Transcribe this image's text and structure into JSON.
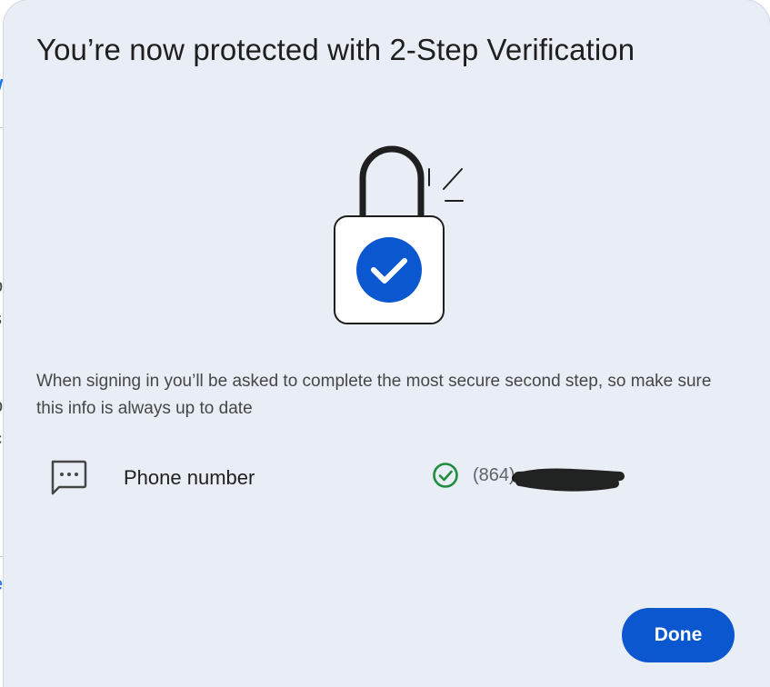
{
  "dialog": {
    "title": "You’re now protected with 2-Step Verification",
    "description": "When signing in you’ll be asked to complete the most secure second step, so make sure this info is always up to date",
    "illustration": "padlock-with-check",
    "info_rows": [
      {
        "icon": "sms-message-icon",
        "label": "Phone number",
        "status_icon": "check-circle-icon",
        "status_color": "#1e8e3e",
        "value": "(864)"
      }
    ],
    "done_label": "Done"
  },
  "background_page": {
    "fragments": [
      "/",
      "i",
      "p",
      "s",
      "r",
      "p",
      "c",
      "e"
    ]
  },
  "colors": {
    "primary": "#0b57d0",
    "dialog_background": "#e9eef6",
    "success": "#1e8e3e",
    "text_primary": "#1f1f1f",
    "text_secondary": "#444746"
  }
}
